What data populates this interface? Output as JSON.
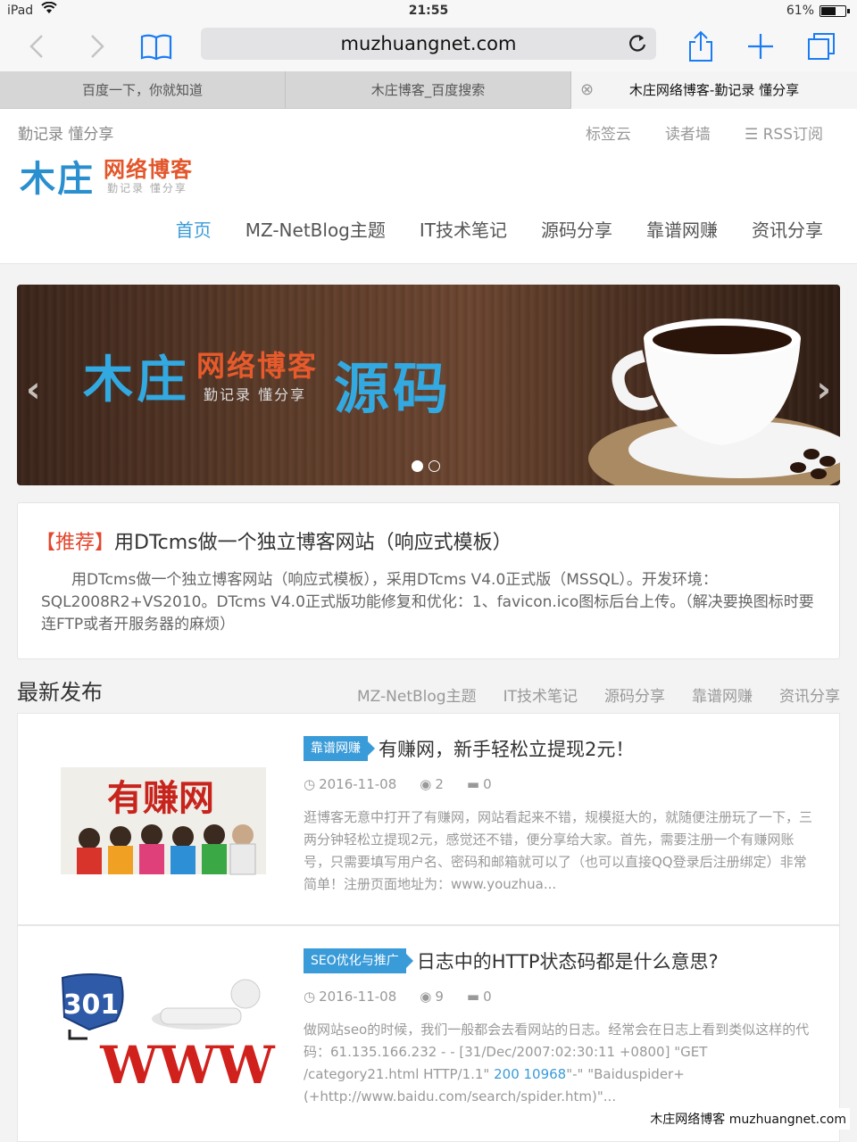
{
  "status": {
    "device": "iPad",
    "time": "21:55",
    "battery": "61%",
    "battery_level": 0.61
  },
  "toolbar": {
    "url": "muzhuangnet.com"
  },
  "tabs": [
    {
      "label": "百度一下，你就知道"
    },
    {
      "label": "木庄博客_百度搜索"
    },
    {
      "label": "木庄网络博客-勤记录 懂分享"
    }
  ],
  "header": {
    "tagline": "勤记录 懂分享",
    "top_links": [
      "标签云",
      "读者墙",
      "RSS订阅"
    ],
    "logo": {
      "main": "木庄",
      "red": "网络博客",
      "sub": "勤记录 懂分享"
    },
    "nav": [
      "首页",
      "MZ-NetBlog主题",
      "IT技术笔记",
      "源码分享",
      "靠谱网赚",
      "资讯分享"
    ]
  },
  "slider": {
    "main": "木庄",
    "red": "网络博客",
    "sub": "勤记录 懂分享",
    "code": "源码",
    "slides": 2,
    "current": 1
  },
  "recommend": {
    "tag": "【推荐】",
    "title": "用DTcms做一个独立博客网站（响应式模板）",
    "body": "用DTcms做一个独立博客网站（响应式模板），采用DTcms V4.0正式版（MSSQL）。开发环境：SQL2008R2+VS2010。DTcms V4.0正式版功能修复和优化：1、favicon.ico图标后台上传。（解决要换图标时要连FTP或者开服务器的麻烦）"
  },
  "latest": {
    "title": "最新发布",
    "categories": [
      "MZ-NetBlog主题",
      "IT技术笔记",
      "源码分享",
      "靠谱网赚",
      "资讯分享"
    ]
  },
  "posts": [
    {
      "badge": "靠谱网赚",
      "title": "有赚网，新手轻松立提现2元！",
      "date": "2016-11-08",
      "views": "2",
      "comments": "0",
      "thumb_text": "有赚网",
      "excerpt": "逛博客无意中打开了有赚网，网站看起来不错，规模挺大的，就随便注册玩了一下，三两分钟轻松立提现2元，感觉还不错，便分享给大家。首先，需要注册一个有赚网账号，只需要填写用户名、密码和邮箱就可以了（也可以直接QQ登录后注册绑定）非常简单！注册页面地址为：www.youzhua..."
    },
    {
      "badge": "SEO优化与推广",
      "title": "日志中的HTTP状态码都是什么意思?",
      "date": "2016-11-08",
      "views": "9",
      "comments": "0",
      "thumb_text_a": "301",
      "thumb_text_b": "WWW",
      "excerpt_a": "做网站seo的时候，我们一般都会去看网站的日志。经常会在日志上看到类似这样的代码：61.135.166.232 - - [31/Dec/2007:02:30:11 +0800] \"GET /category21.html HTTP/1.1\" ",
      "excerpt_blue": "200 10968",
      "excerpt_b": "\"-\" \"Baiduspider+(+http://www.baidu.com/search/spider.htm)\"..."
    }
  ],
  "watermark": "木庄网络博客 muzhuangnet.com"
}
